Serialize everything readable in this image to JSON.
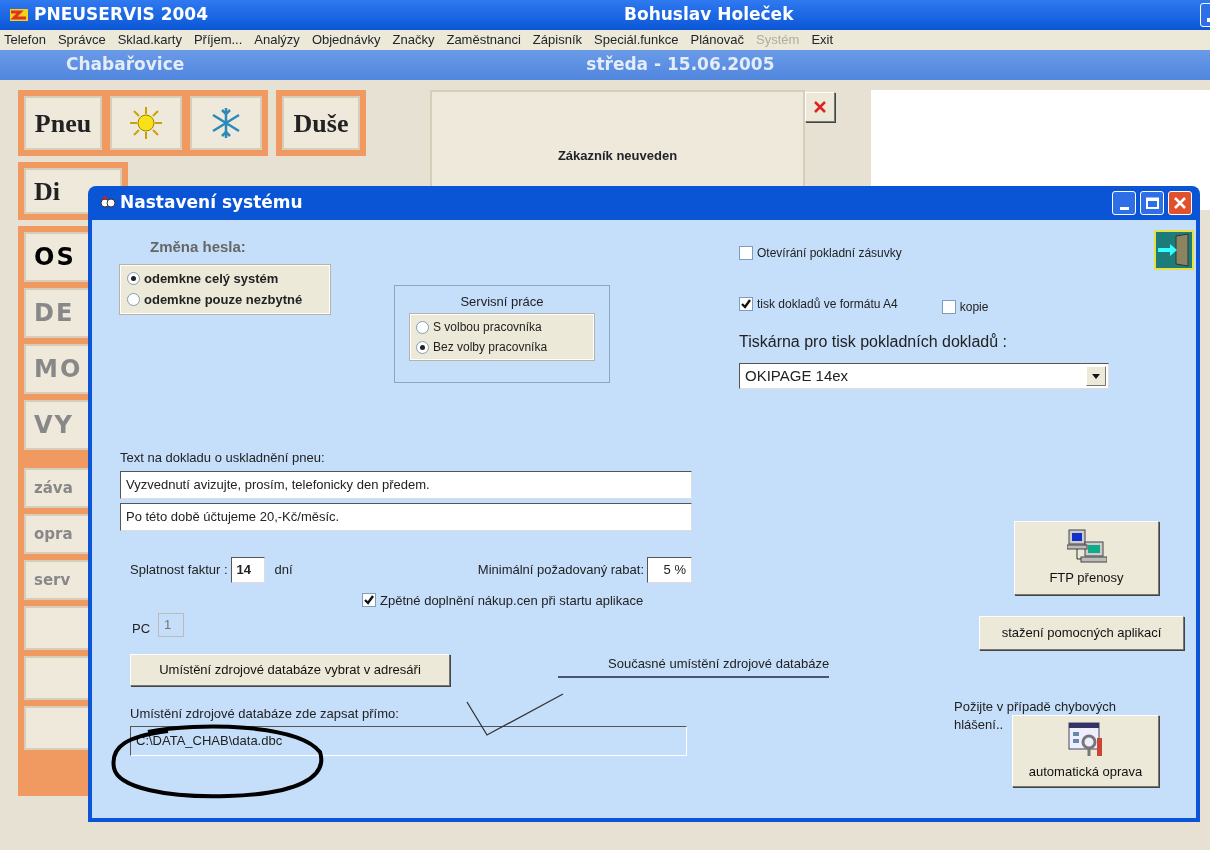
{
  "app": {
    "title": "PNEUSERVIS 2004",
    "user": "Bohuslav Holeček",
    "location": "Chabařovice",
    "date": "středa - 15.06.2005",
    "menu": [
      {
        "label": "Telefon",
        "disabled": false
      },
      {
        "label": "Správce",
        "disabled": false
      },
      {
        "label": "Sklad.karty",
        "disabled": false
      },
      {
        "label": "Příjem...",
        "disabled": false
      },
      {
        "label": "Analýzy",
        "disabled": false
      },
      {
        "label": "Objednávky",
        "disabled": false
      },
      {
        "label": "Značky",
        "disabled": false
      },
      {
        "label": "Zaměstnanci",
        "disabled": false
      },
      {
        "label": "Zápisník",
        "disabled": false
      },
      {
        "label": "Speciál.funkce",
        "disabled": false
      },
      {
        "label": "Plánovač",
        "disabled": false
      },
      {
        "label": "Systém",
        "disabled": true
      },
      {
        "label": "Exit",
        "disabled": false
      }
    ]
  },
  "left_panel": {
    "top_buttons": [
      {
        "kind": "text",
        "label": "Pneu"
      },
      {
        "kind": "sun"
      },
      {
        "kind": "snowflake"
      },
      {
        "kind": "text",
        "label": "Duše"
      }
    ],
    "second_button": "Di",
    "categories": [
      {
        "label": "OS",
        "active": true
      },
      {
        "label": "DE",
        "active": false
      },
      {
        "label": "MO",
        "active": false
      },
      {
        "label": "VY",
        "active": false
      }
    ],
    "small_buttons": [
      "záva",
      "opra",
      "serv"
    ]
  },
  "customer": {
    "label": "Zákazník neuveden"
  },
  "dialog": {
    "title": "Nastavení systému",
    "password": {
      "label": "Změna hesla:",
      "options": [
        {
          "label": "odemkne celý systém",
          "selected": true
        },
        {
          "label": "odemkne pouze nezbytné",
          "selected": false
        }
      ]
    },
    "service_work": {
      "label": "Servisní práce",
      "options": [
        {
          "label": "S volbou pracovníka",
          "selected": false
        },
        {
          "label": "Bez volby pracovníka",
          "selected": true
        }
      ]
    },
    "cash_drawer": {
      "label": "Otevírání pokladní zásuvky",
      "checked": false
    },
    "print_a4": {
      "label": "tisk dokladů ve formátu A4",
      "checked": true
    },
    "copy": {
      "label": "kopie",
      "checked": false
    },
    "printer": {
      "label": "Tiskárna pro tisk pokladních dokladů :",
      "value": "OKIPAGE 14ex"
    },
    "storage_text": {
      "label": "Text na dokladu o uskladnění pneu:",
      "lines": [
        "Vyzvednutí avizujte, prosím, telefonicky den předem.",
        "Po této době účtujeme 20,-Kč/měsíc."
      ]
    },
    "due": {
      "label": "Splatnost faktur :",
      "value": "14",
      "unit": "dní"
    },
    "discount": {
      "label": "Minimální požadovaný rabat:",
      "value": "5 %"
    },
    "backfill": {
      "label": "Zpětné doplnění nákup.cen při startu aplikace",
      "checked": true
    },
    "pc": {
      "label": "PC",
      "value": "1",
      "disabled": true
    },
    "browse_button": "Umístění zdrojové databáze vybrat v adresáři",
    "current_location_note": "Současné umístění zdrojové databáze",
    "path": {
      "label": "Umístění zdrojové databáze zde zapsat přímo:",
      "value": "C:\\DATA_CHAB\\data.dbc"
    },
    "ftp_button": "FTP přenosy",
    "download_button": "stažení pomocných aplikací",
    "repair_hint": "Požijte v případě chybových hlášení..",
    "repair_button": "automatická oprava"
  }
}
